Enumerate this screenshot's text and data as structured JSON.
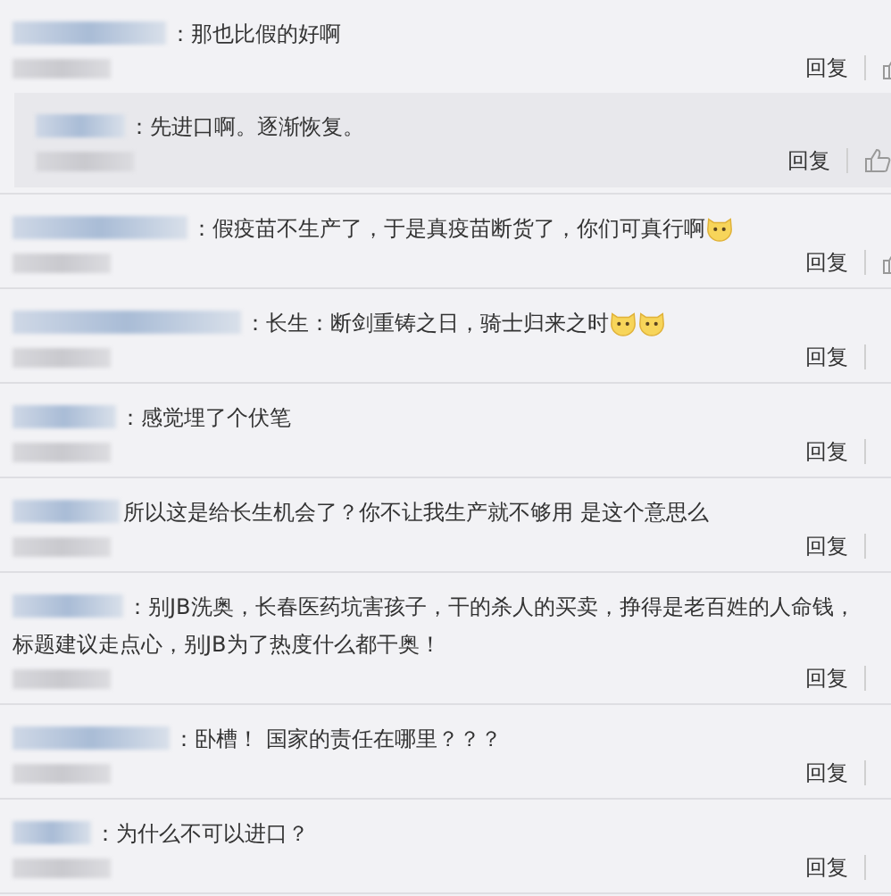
{
  "comments": [
    {
      "kind": "comment",
      "lines": [
        "：那也比假的好啊"
      ],
      "reply_label": "回复",
      "like_icon": true,
      "replies": [
        {
          "kind": "reply",
          "lines": [
            "：先进口啊。逐渐恢复。"
          ],
          "reply_label": "回复",
          "like_icon": true
        }
      ]
    },
    {
      "kind": "comment",
      "lines": [
        "：假疫苗不生产了，于是真疫苗断货了，你们可真行啊"
      ],
      "emojis": [
        {
          "kind": "cat"
        }
      ],
      "reply_label": "回复",
      "like_icon": true
    },
    {
      "kind": "comment",
      "lines": [
        "：长生：断剑重铸之日，骑士归来之时"
      ],
      "emojis": [
        {
          "kind": "cat"
        },
        {
          "kind": "cat"
        }
      ],
      "reply_label": "回复",
      "like_icon": false
    },
    {
      "kind": "comment",
      "lines": [
        "：感觉埋了个伏笔"
      ],
      "reply_label": "回复",
      "like_icon": false
    },
    {
      "kind": "comment",
      "lines": [
        "所以这是给长生机会了？你不让我生产就不够用 是这个意思么"
      ],
      "reply_label": "回复",
      "like_icon": false
    },
    {
      "kind": "comment",
      "lines": [
        "：别JB洗奥，长春医药坑害孩子，干的杀人的买卖，挣得是老百姓的人命钱，",
        "标题建议走点心，别JB为了热度什么都干奥！"
      ],
      "reply_label": "回复",
      "like_icon": false
    },
    {
      "kind": "comment",
      "lines": [
        "：卧槽！ 国家的责任在哪里？？？"
      ],
      "reply_label": "回复",
      "like_icon": false
    },
    {
      "kind": "comment",
      "lines": [
        "：为什么不可以进口？"
      ],
      "reply_label": "回复",
      "like_icon": false
    }
  ]
}
